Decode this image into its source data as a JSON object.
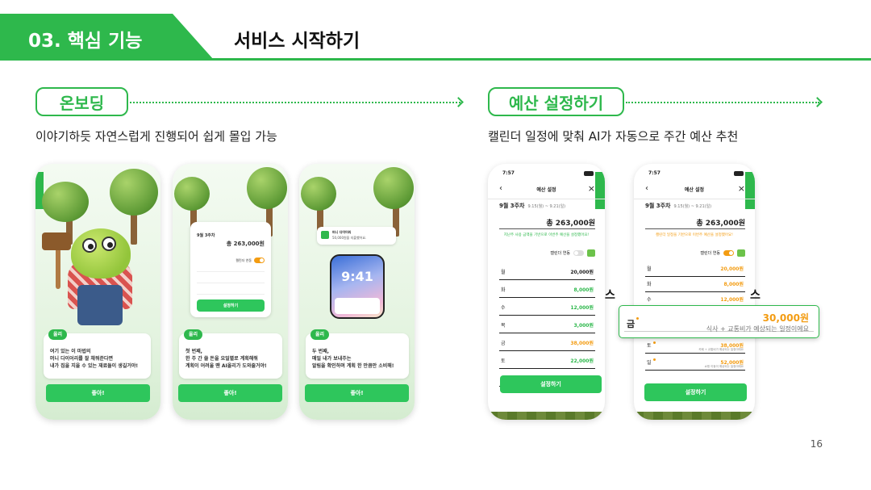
{
  "header": {
    "section": "03. 핵심 기능",
    "title": "서비스 시작하기"
  },
  "sections": {
    "onboarding": {
      "label": "온보딩",
      "subtitle": "이야기하듯 자연스럽게 진행되어 쉽게 몰입 가능"
    },
    "budget": {
      "label": "예산 설정하기",
      "subtitle": "캘린더 일정에 맞춰 AI가 자동으로 주간 예산 추천"
    }
  },
  "phone1": {
    "speaker": "올리",
    "message": "여기 있는 이 마법의\n머니 다이어리를 잘 채워준다면\n내가 집을 지을 수 있는 재료들이 생길거야!",
    "button": "좋아!"
  },
  "phone2": {
    "card": {
      "week": "9월 3주차",
      "total": "총 263,000원",
      "toggle": "캘린더 연동",
      "button": "설정하기"
    },
    "speaker": "올리",
    "message": "첫 번째,\n한 주 간 쓸 돈을 요일별로 계획해줘\n계획이 어려울 땐 AI올리가 도와줄거야!",
    "button": "좋아!"
  },
  "phone3": {
    "notification": {
      "app": "머니 다이어리",
      "text": "50,000원을 지출했어요."
    },
    "clock": "9:41",
    "speaker": "올리",
    "message": "두 번째,\n매일 내가 보내주는\n알림을 확인하며 계획 한 만큼만 소비해!",
    "button": "좋아!"
  },
  "budget_screen": {
    "time": "7:57",
    "title": "예산 설정",
    "week": "9월 3주차",
    "range": "9.15(월) ~ 9.21(일)",
    "total": "총 263,000원",
    "hint_a": "지난주 사용 금액을 기반으로 이번주 예산을 설정했어요!",
    "hint_b": "캘린더 일정을 기반으로 이번주 예산을 설정했어요!",
    "toggle_label": "캘린더 연동",
    "button": "설정하기"
  },
  "budget_a_days": [
    {
      "day": "월",
      "value": "20,000원",
      "tone": "dark"
    },
    {
      "day": "화",
      "value": "8,000원",
      "tone": "green"
    },
    {
      "day": "수",
      "value": "12,000원",
      "tone": "green"
    },
    {
      "day": "목",
      "value": "3,000원",
      "tone": "green"
    },
    {
      "day": "금",
      "value": "38,000원",
      "tone": "orange"
    },
    {
      "day": "토",
      "value": "22,000원",
      "tone": "green"
    },
    {
      "day": "일",
      "value": "42,000원",
      "tone": "green"
    }
  ],
  "budget_b_days": [
    {
      "day": "월",
      "value": "20,000원"
    },
    {
      "day": "화",
      "value": "8,000원"
    },
    {
      "day": "수",
      "value": "12,000원"
    },
    {
      "day": "토",
      "value": "38,000원",
      "note": "카페 + 교통비가 예상되는 일정이에요"
    },
    {
      "day": "일",
      "value": "52,000원",
      "note": "쇼핑 이동이 예상되는 일정이에요"
    }
  ],
  "popup": {
    "day": "금",
    "value": "30,000원",
    "note": "식사 + 교통비가 예상되는 일정이에요"
  },
  "edge_text": "스",
  "page_number": "16"
}
